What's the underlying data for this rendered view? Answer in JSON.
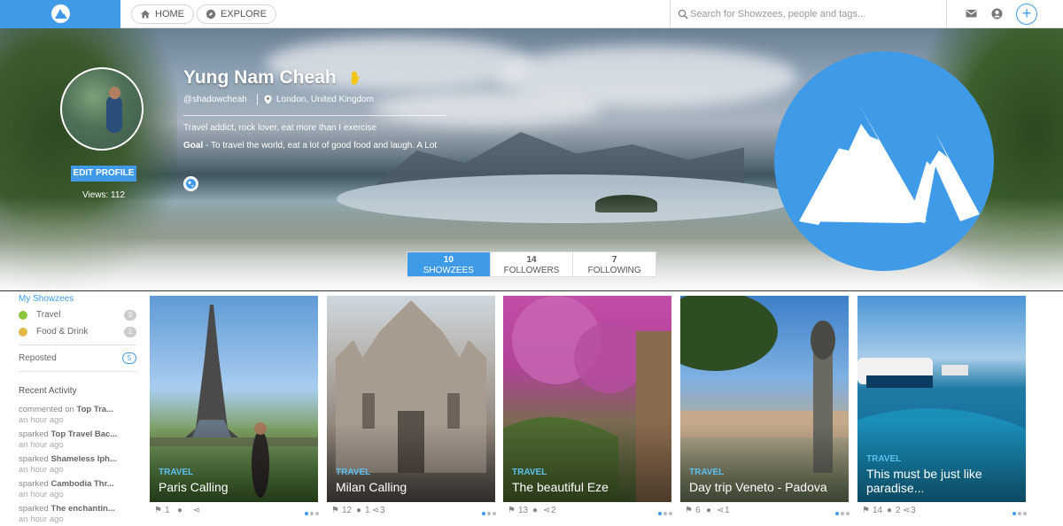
{
  "topbar": {
    "nav": [
      {
        "label": "HOME",
        "icon": "home-icon"
      },
      {
        "label": "EXPLORE",
        "icon": "compass-icon"
      }
    ],
    "search_placeholder": "Search for Showzees, people and tags...",
    "plus_label": "+"
  },
  "profile": {
    "name": "Yung Nam Cheah",
    "handle": "@shadowcheah",
    "location": "London, United Kingdom",
    "bio": "Travel addict, rock lover, eat more than I exercise",
    "goal_label": "Goal",
    "goal_text": " - To travel the world, eat a lot of good food and laugh. A Lot",
    "edit_label": "EDIT PROFILE",
    "views": "Views: 112"
  },
  "stats": [
    {
      "num": "10",
      "label": "SHOWZEES",
      "active": true
    },
    {
      "num": "14",
      "label": "FOLLOWERS",
      "active": false
    },
    {
      "num": "7",
      "label": "FOLLOWING",
      "active": false
    }
  ],
  "sidebar": {
    "title": "My Showzees",
    "items": [
      {
        "label": "Travel",
        "count": "9",
        "color": "#8cc63f"
      },
      {
        "label": "Food & Drink",
        "count": "1",
        "color": "#e0b84a"
      }
    ],
    "reposted_label": "Reposted",
    "reposted_count": "5",
    "activity_title": "Recent Activity",
    "activity": [
      {
        "verb": "commented on ",
        "target": "Top Tra...",
        "time": "an hour ago"
      },
      {
        "verb": "sparked ",
        "target": "Top Travel Bac...",
        "time": "an hour ago"
      },
      {
        "verb": "sparked ",
        "target": "Shameless Iph...",
        "time": "an hour ago"
      },
      {
        "verb": "sparked ",
        "target": "Cambodia Thr...",
        "time": "an hour ago"
      },
      {
        "verb": "sparked ",
        "target": "The enchantin...",
        "time": "an hour ago"
      }
    ]
  },
  "cards": [
    {
      "category": "TRAVEL",
      "title": "Paris Calling",
      "reposts": "1",
      "comments": "",
      "shares": "",
      "active_dot": 0
    },
    {
      "category": "TRAVEL",
      "title": "Milan Calling",
      "reposts": "12",
      "comments": "1",
      "shares": "3",
      "active_dot": 0
    },
    {
      "category": "TRAVEL",
      "title": "The beautiful Eze",
      "reposts": "13",
      "comments": "",
      "shares": "2",
      "active_dot": 0
    },
    {
      "category": "TRAVEL",
      "title": "Day trip Veneto - Padova",
      "reposts": "6",
      "comments": "",
      "shares": "1",
      "active_dot": 0
    },
    {
      "category": "TRAVEL",
      "title": "This must be just like paradise...",
      "reposts": "14",
      "comments": "2",
      "shares": "3",
      "active_dot": 0
    }
  ],
  "colors": {
    "accent": "#3f9ae8",
    "category": "#5bc0f0"
  }
}
